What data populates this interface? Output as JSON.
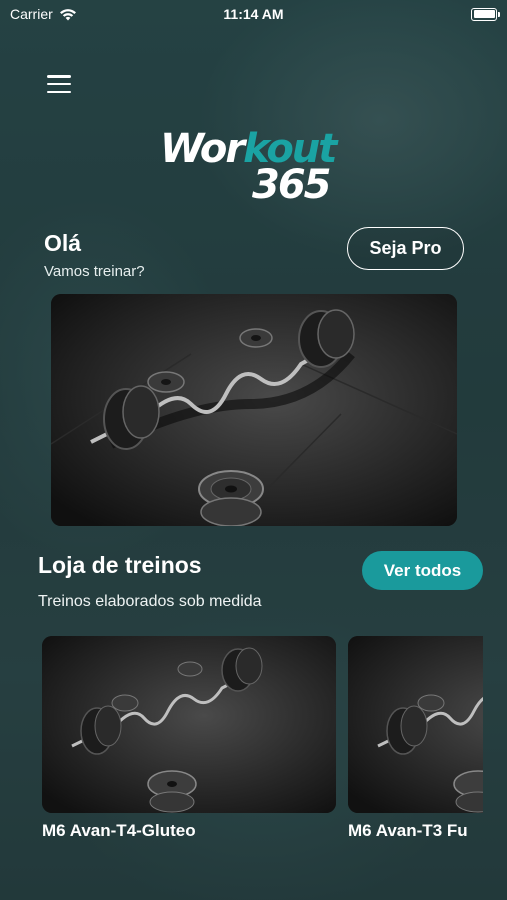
{
  "status_bar": {
    "carrier": "Carrier",
    "time": "11:14 AM"
  },
  "logo": {
    "part1": "Wor",
    "part2": "kout",
    "part3": "365"
  },
  "greeting": {
    "title": "Olá",
    "subtitle": "Vamos treinar?",
    "pro_button": "Seja Pro"
  },
  "store": {
    "title": "Loja de treinos",
    "subtitle": "Treinos elaborados sob medida",
    "see_all": "Ver todos",
    "items": [
      {
        "title": "M6 Avan-T4-Gluteo"
      },
      {
        "title": "M6 Avan-T3 Fu"
      }
    ]
  },
  "colors": {
    "accent": "#1a9a9c",
    "logo_teal": "#1aa3a3",
    "background": "#2c4a4b"
  },
  "icons": [
    "wifi-icon",
    "battery-icon",
    "menu-icon"
  ]
}
